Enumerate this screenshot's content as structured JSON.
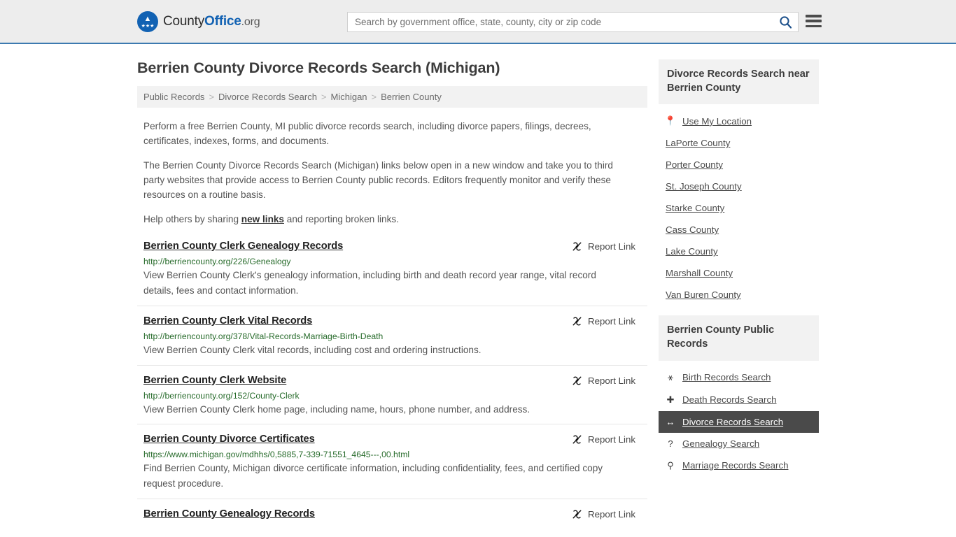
{
  "header": {
    "logo_primary": "County",
    "logo_bold": "Office",
    "logo_suffix": ".org",
    "search_placeholder": "Search by government office, state, county, city or zip code",
    "search_value": "",
    "search_icon": "search-icon",
    "menu_icon": "hamburger-menu-icon"
  },
  "page": {
    "title": "Berrien County Divorce Records Search (Michigan)"
  },
  "breadcrumb": {
    "items": [
      {
        "label": "Public Records"
      },
      {
        "label": "Divorce Records Search"
      },
      {
        "label": "Michigan"
      },
      {
        "label": "Berrien County"
      }
    ],
    "separator": ">"
  },
  "intro": {
    "p1": "Perform a free Berrien County, MI public divorce records search, including divorce papers, filings, decrees, certificates, indexes, forms, and documents.",
    "p2": "The Berrien County Divorce Records Search (Michigan) links below open in a new window and take you to third party websites that provide access to Berrien County public records. Editors frequently monitor and verify these resources on a routine basis.",
    "p3_before": "Help others by sharing ",
    "p3_link": "new links",
    "p3_after": " and reporting broken links."
  },
  "results": {
    "report_label": "Report Link",
    "report_icon": "broken-link-icon",
    "items": [
      {
        "title": "Berrien County Clerk Genealogy Records",
        "url": "http://berriencounty.org/226/Genealogy",
        "description": "View Berrien County Clerk's genealogy information, including birth and death record year range, vital record details, fees and contact information."
      },
      {
        "title": "Berrien County Clerk Vital Records",
        "url": "http://berriencounty.org/378/Vital-Records-Marriage-Birth-Death",
        "description": "View Berrien County Clerk vital records, including cost and ordering instructions."
      },
      {
        "title": "Berrien County Clerk Website",
        "url": "http://berriencounty.org/152/County-Clerk",
        "description": "View Berrien County Clerk home page, including name, hours, phone number, and address."
      },
      {
        "title": "Berrien County Divorce Certificates",
        "url": "https://www.michigan.gov/mdhhs/0,5885,7-339-71551_4645---,00.html",
        "description": "Find Berrien County, Michigan divorce certificate information, including confidentiality, fees, and certified copy request procedure."
      },
      {
        "title": "Berrien County Genealogy Records",
        "url": "",
        "description": ""
      }
    ]
  },
  "sidebar": {
    "nearby": {
      "heading": "Divorce Records Search near Berrien County",
      "items": [
        {
          "label": "Use My Location",
          "icon": "map-pin-icon"
        },
        {
          "label": "LaPorte County",
          "icon": ""
        },
        {
          "label": "Porter County",
          "icon": ""
        },
        {
          "label": "St. Joseph County",
          "icon": ""
        },
        {
          "label": "Starke County",
          "icon": ""
        },
        {
          "label": "Cass County",
          "icon": ""
        },
        {
          "label": "Lake County",
          "icon": ""
        },
        {
          "label": "Marshall County",
          "icon": ""
        },
        {
          "label": "Van Buren County",
          "icon": ""
        }
      ]
    },
    "public_records": {
      "heading": "Berrien County Public Records",
      "items": [
        {
          "label": "Birth Records Search",
          "icon": "baby-icon",
          "active": false
        },
        {
          "label": "Death Records Search",
          "icon": "cross-icon",
          "active": false
        },
        {
          "label": "Divorce Records Search",
          "icon": "split-arrows-icon",
          "active": true
        },
        {
          "label": "Genealogy Search",
          "icon": "question-mark-icon",
          "active": false
        },
        {
          "label": "Marriage Records Search",
          "icon": "gender-symbols-icon",
          "active": false
        }
      ]
    }
  },
  "colors": {
    "accent_blue": "#1262b3",
    "header_border": "#3d7ab0",
    "url_green": "#276b2b",
    "active_bg": "#4a4a4a",
    "panel_bg": "#f2f2f2"
  }
}
